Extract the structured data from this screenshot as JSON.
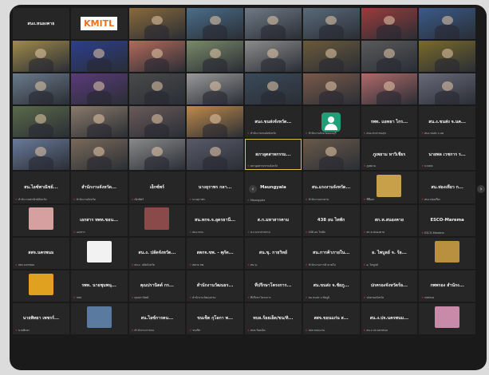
{
  "colors": {
    "background": "#1a1a1a",
    "tile": "#262626",
    "mic_muted": "#e03b3b",
    "active_speaker": "#d8c73a",
    "avatar_green": "#1f9e78"
  },
  "pager": {
    "left_icon": "chevron-left-icon",
    "right_icon": "chevron-right-icon",
    "left": "‹",
    "right": "›"
  },
  "tiles": [
    {
      "type": "name",
      "name": "สนง.หนองคาย",
      "sub": ""
    },
    {
      "type": "logo",
      "logo": "KMITL",
      "sub": ""
    },
    {
      "type": "video",
      "bg": "#8a6a3a",
      "sub": ""
    },
    {
      "type": "video",
      "bg": "#4a6e8a",
      "sub": ""
    },
    {
      "type": "video",
      "bg": "#6f7a86",
      "sub": ""
    },
    {
      "type": "video",
      "bg": "#5a6a7a",
      "sub": ""
    },
    {
      "type": "video",
      "bg": "#9c3b3b",
      "sub": ""
    },
    {
      "type": "video",
      "bg": "#3a5a8a",
      "sub": ""
    },
    {
      "type": "video",
      "bg": "#a08a4a",
      "sub": ""
    },
    {
      "type": "video",
      "bg": "#2c3e8f",
      "sub": ""
    },
    {
      "type": "video",
      "bg": "#b46a5a",
      "sub": ""
    },
    {
      "type": "video",
      "bg": "#7a8a6a",
      "sub": ""
    },
    {
      "type": "video",
      "bg": "#8c8c8c",
      "sub": ""
    },
    {
      "type": "video",
      "bg": "#6a5a3a",
      "sub": ""
    },
    {
      "type": "video",
      "bg": "#5a5a5a",
      "sub": ""
    },
    {
      "type": "video",
      "bg": "#7a6a2a",
      "sub": ""
    },
    {
      "type": "video",
      "bg": "#6a7a8a",
      "sub": ""
    },
    {
      "type": "video",
      "bg": "#5a3a7a",
      "sub": ""
    },
    {
      "type": "video",
      "bg": "#4a4a4a",
      "sub": ""
    },
    {
      "type": "video",
      "bg": "#9a9a9a",
      "sub": ""
    },
    {
      "type": "video",
      "bg": "#3a4a5a",
      "sub": ""
    },
    {
      "type": "video",
      "bg": "#7a5a4a",
      "sub": ""
    },
    {
      "type": "video",
      "bg": "#b06a6a",
      "sub": ""
    },
    {
      "type": "video",
      "bg": "#6a6a7a",
      "sub": ""
    },
    {
      "type": "video",
      "bg": "#5a6a4a",
      "sub": ""
    },
    {
      "type": "video",
      "bg": "#8a7a6a",
      "sub": ""
    },
    {
      "type": "video",
      "bg": "#6a5a5a",
      "sub": ""
    },
    {
      "type": "video",
      "bg": "#c08a4a",
      "sub": ""
    },
    {
      "type": "name",
      "name": "สนง.ขนส่งจังหวัด...",
      "sub": "สำนักงานขนส่งจังหวัด"
    },
    {
      "type": "avatar",
      "sub": "สำนักงานจังหวัดนนทบุรี"
    },
    {
      "type": "name",
      "name": "รพท. แอทธา ไกร...",
      "sub": "สนง.สาธารณสุข"
    },
    {
      "type": "name",
      "name": "สน.ง.ขนส่ง จ.นค...",
      "sub": "สนง.ขนส่ง จ.นค"
    },
    {
      "type": "video",
      "bg": "#6a7a9a",
      "sub": ""
    },
    {
      "type": "video",
      "bg": "#7a6a5a",
      "sub": ""
    },
    {
      "type": "video",
      "bg": "#8a8a8a",
      "sub": ""
    },
    {
      "type": "video",
      "bg": "#5a5a6a",
      "sub": ""
    },
    {
      "type": "name",
      "name": "สภาอุตสาหกรรม...",
      "sub": "สภาอุตสาหกรรมจังหวัด",
      "active": true
    },
    {
      "type": "video",
      "bg": "#6a5a4a",
      "sub": ""
    },
    {
      "type": "name",
      "name": "ภูเพยาม หาวิเชียร",
      "sub": "ภูเพยาม"
    },
    {
      "type": "name",
      "name": "นายพล เวชการ ร...",
      "sub": "นายพล"
    },
    {
      "type": "name",
      "name": "สน.ไอซ์พาณิชย์...",
      "sub": "สำนักงานพาณิชย์จังหวัด"
    },
    {
      "type": "name",
      "name": "สำนักงานจังหวัด...",
      "sub": "สำนักงานจังหวัด"
    },
    {
      "type": "name",
      "name": "เอ็กซ์พร์",
      "sub": "เอ็กซ์พร์"
    },
    {
      "type": "name",
      "name": "นางอุราพร กลา...",
      "sub": "นางอุราพร"
    },
    {
      "type": "name",
      "name": "Maungyala",
      "sub": "Maungyala"
    },
    {
      "type": "name",
      "name": "สน.แรงงานจังหวัด...",
      "sub": "สำนักงานแรงงาน"
    },
    {
      "type": "img",
      "bg": "#c9a04a",
      "sub": "ซีพีเอฟ"
    },
    {
      "type": "name",
      "name": "สน.ท่องเที่ยว ก...",
      "sub": "สนง.ท่องเที่ยว"
    },
    {
      "type": "img",
      "bg": "#d7a0a0",
      "sub": ""
    },
    {
      "type": "name",
      "name": "เอกสาร ททท.ขอน...",
      "sub": "เอกสาร"
    },
    {
      "type": "img",
      "bg": "#8a4a4a",
      "sub": ""
    },
    {
      "type": "name",
      "name": "สน.ทกจ.จ.อุดรธานี...",
      "sub": "สนง.ทกจ."
    },
    {
      "type": "name",
      "name": "ส.ก.มหาสารคาม",
      "sub": "ส.ก.มหาสารคาม"
    },
    {
      "type": "name",
      "name": "438 อน ไทพัก",
      "sub": "438 อน ไทพัก"
    },
    {
      "type": "name",
      "name": "สก.ห.สนองคาย",
      "sub": "สก.ห.สนองคาย"
    },
    {
      "type": "name",
      "name": "ESCO-Marema",
      "sub": "ESCO-Marema"
    },
    {
      "type": "name",
      "name": "สสจ.นครพนม",
      "sub": "สสจ.นครพนม"
    },
    {
      "type": "img",
      "bg": "#f2f2f2",
      "sub": ""
    },
    {
      "type": "name",
      "name": "สน.ง. ปลัดจังหวัด...",
      "sub": "สน.ง. ปลัดจังหวัด"
    },
    {
      "type": "name",
      "name": "สตกจ.ขพ. - คุกัต...",
      "sub": "สตกจ.ขพ."
    },
    {
      "type": "name",
      "name": "สน.ขุ. กายวิทย์",
      "sub": "สน.ขุ."
    },
    {
      "type": "name",
      "name": "สน.การค้าภายใน...",
      "sub": "สำนักงานการค้าภายใน"
    },
    {
      "type": "name",
      "name": "อ. ไพบูลย์ จ. ร้อ...",
      "sub": "อ. ไพบูลย์"
    },
    {
      "type": "img",
      "bg": "#b89040",
      "sub": ""
    },
    {
      "type": "img",
      "bg": "#e0a020",
      "sub": ""
    },
    {
      "type": "name",
      "name": "รพท. นายชุมพนุ...",
      "sub": "รพท."
    },
    {
      "type": "name",
      "name": "คุณปรานิตต์ กร...",
      "sub": "คุณปรานิตต์"
    },
    {
      "type": "name",
      "name": "สำนักงานวัฒนธร...",
      "sub": "สำนักงานวัฒนธรรม"
    },
    {
      "type": "name",
      "name": "ที่ปรึกษาโครงการ...",
      "sub": "ที่ปรึกษาโครงการ"
    },
    {
      "type": "name",
      "name": "สน.ขนส่ง จ.ชัยภู...",
      "sub": "สน.ขนส่ง จ.ชัยภูมิ"
    },
    {
      "type": "name",
      "name": "ปกครองจังหวัดร้อ...",
      "sub": "ปกครองจังหวัด"
    },
    {
      "type": "name",
      "name": "กพพรอง สำนักง...",
      "sub": "กพพรอง"
    },
    {
      "type": "name",
      "name": "นายพิทยา เพชรร์...",
      "sub": "นายพิทยา"
    },
    {
      "type": "img",
      "bg": "#5a7aa0",
      "sub": ""
    },
    {
      "type": "name",
      "name": "สน.ไอซ์การคน...",
      "sub": "สำนักงานการคน"
    },
    {
      "type": "name",
      "name": "ขนเช็ต กุโลกา พ...",
      "sub": "ขนเช็ต"
    },
    {
      "type": "name",
      "name": "ทบล.ร้อยเอ็ด/ขน/ทิ...",
      "sub": "ทบล.ร้อยเอ็ด"
    },
    {
      "type": "name",
      "name": "สสจ.ขอนแก่น ส...",
      "sub": "สสจ.ขอนแก่น"
    },
    {
      "type": "name",
      "name": "สน.ง.ปจ.นครพนม...",
      "sub": "สน.ง.ปจ.นครพนม"
    },
    {
      "type": "img",
      "bg": "#c88aa8",
      "sub": ""
    }
  ]
}
